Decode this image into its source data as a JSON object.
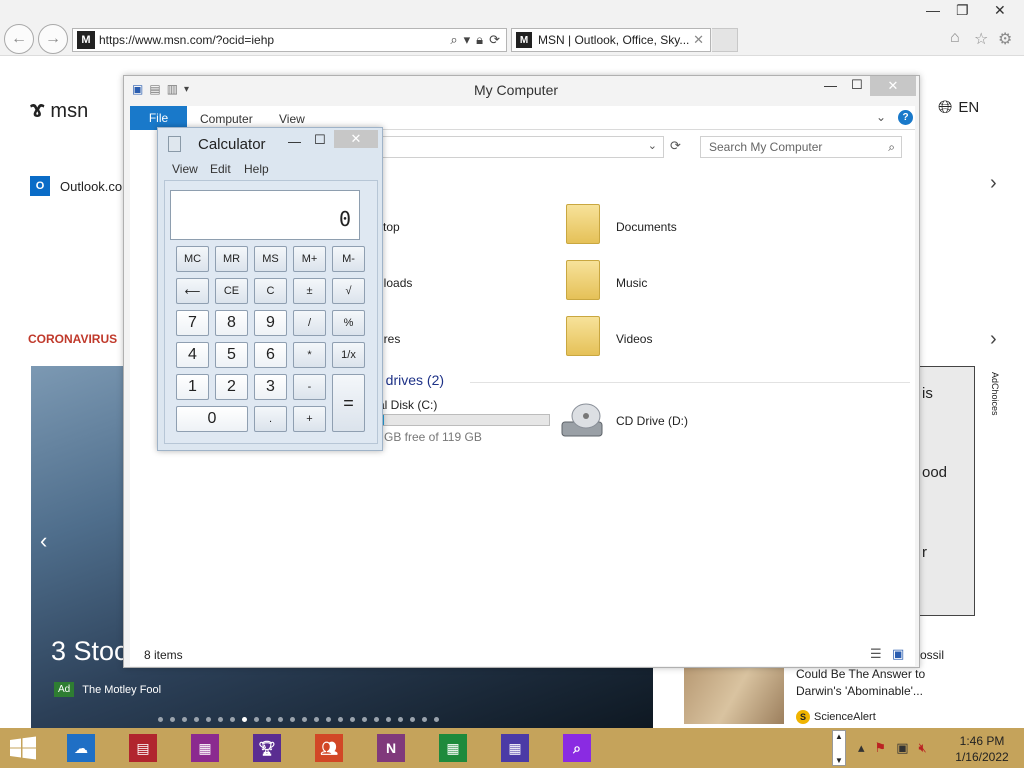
{
  "browser": {
    "url": "https://www.msn.com/?ocid=iehp",
    "tab_title": "MSN | Outlook, Office, Sky...",
    "favicon_letter": "M"
  },
  "msn": {
    "logo": "msn",
    "language": "EN",
    "outlook_label": "Outlook.co",
    "coronavirus_label": "CORONAVIRUS",
    "hero_title": "3 Stoc",
    "hero_ad_badge": "Ad",
    "hero_ad_source": "The Motley Fool",
    "ad_choices": "AdChoices",
    "ad_fragments": [
      "is",
      "ood",
      "r"
    ],
    "news_text": "Could Be The Answer to Darwin's 'Abominable'...",
    "news_text_top": "ossil",
    "news_source": "ScienceAlert",
    "news_source_initial": "S"
  },
  "explorer": {
    "title": "My Computer",
    "ribbon": {
      "file": "File",
      "computer": "Computer",
      "view": "View"
    },
    "search_placeholder": "Search My Computer",
    "folders": [
      {
        "label": "ktop"
      },
      {
        "label": "Documents"
      },
      {
        "label": "nloads"
      },
      {
        "label": "Music"
      },
      {
        "label": "ures"
      },
      {
        "label": "Videos"
      }
    ],
    "drives_heading": "d drives (2)",
    "disk_label": "al Disk (C:)",
    "disk_free": "GB free of 119 GB",
    "disk_used_fraction": 0.05,
    "cd_label": "CD Drive (D:)",
    "status": "8 items"
  },
  "calculator": {
    "title": "Calculator",
    "menu": {
      "view": "View",
      "edit": "Edit",
      "help": "Help"
    },
    "display": "0",
    "keys": {
      "mc": "MC",
      "mr": "MR",
      "ms": "MS",
      "mplus": "M+",
      "mminus": "M-",
      "back": "⟵",
      "ce": "CE",
      "c": "C",
      "plusminus": "±",
      "sqrt": "√",
      "n7": "7",
      "n8": "8",
      "n9": "9",
      "div": "/",
      "pct": "%",
      "n4": "4",
      "n5": "5",
      "n6": "6",
      "mul": "*",
      "recip": "1/x",
      "n1": "1",
      "n2": "2",
      "n3": "3",
      "sub": "-",
      "eq": "=",
      "n0": "0",
      "dot": ".",
      "add": "+"
    }
  },
  "taskbar": {
    "time": "1:46 PM",
    "date": "1/16/2022"
  },
  "colors": {
    "accent": "#1979ca",
    "taskbar": "#c5a35b",
    "coronavirus": "#c0392b"
  }
}
